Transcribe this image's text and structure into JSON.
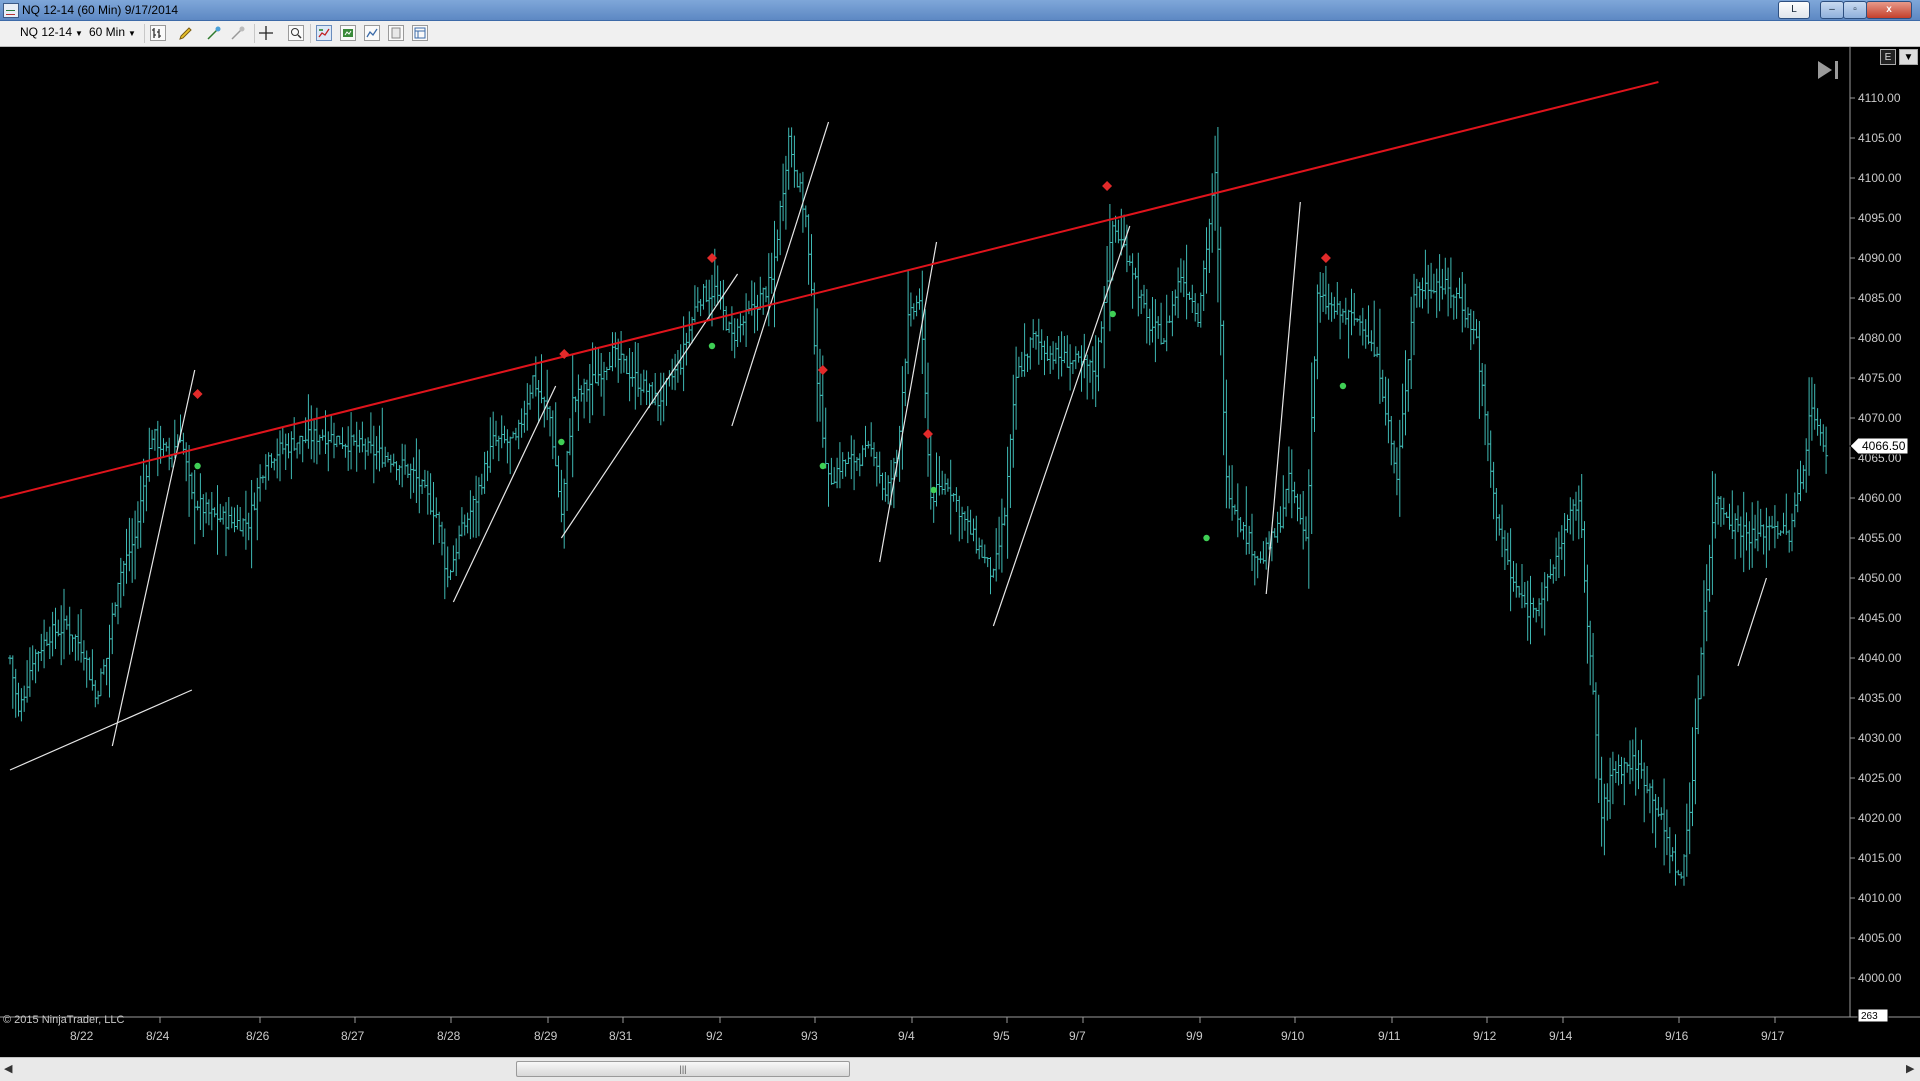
{
  "window": {
    "title": "NQ 12-14 (60 Min)  9/17/2014",
    "btn_l": "L",
    "btn_min": "–",
    "btn_max": "▫",
    "btn_close": "x"
  },
  "toolbar": {
    "instrument": "NQ 12-14",
    "interval": "60 Min",
    "icons": [
      "bar-type-icon",
      "drawing-pencil-icon",
      "draw-tools-icon",
      "drawing-objects-icon",
      "crosshair-icon",
      "data-box-icon",
      "indicators-icon",
      "strategies-icon",
      "chart-properties-icon",
      "templates-icon",
      "chart-panel-icon"
    ]
  },
  "chart": {
    "copyright": "© 2015 NinjaTrader, LLC",
    "current_price_label": "4066.50",
    "bottom_badge": "263",
    "corner_icon": "E",
    "scroll_to_end_icon": "scroll-to-end-icon",
    "background": "#000000",
    "bar_color": "#3fb9b4",
    "trendline_color": "#e0141c",
    "channel_color": "#e6e6e6",
    "marker_up_color": "#3fcf55",
    "marker_down_color": "#e22a2a"
  },
  "chart_data": {
    "type": "bar",
    "title": "",
    "instrument": "NQ 12-14",
    "interval": "60 Min",
    "price_axis": {
      "ylim": [
        3998,
        4114
      ],
      "ticks": [
        "4110.00",
        "4105.00",
        "4100.00",
        "4095.00",
        "4090.00",
        "4085.00",
        "4080.00",
        "4075.00",
        "4070.00",
        "4065.00",
        "4060.00",
        "4055.00",
        "4050.00",
        "4045.00",
        "4040.00",
        "4035.00",
        "4030.00",
        "4025.00",
        "4020.00",
        "4015.00",
        "4010.00",
        "4005.00",
        "4000.00"
      ]
    },
    "date_axis": {
      "labels": [
        "8/22",
        "8/24",
        "8/26",
        "8/27",
        "8/28",
        "8/29",
        "8/31",
        "9/2",
        "9/3",
        "9/4",
        "9/5",
        "9/7",
        "9/9",
        "9/10",
        "9/11",
        "9/12",
        "9/14",
        "9/16",
        "9/17"
      ]
    },
    "grid": false,
    "legend": "none",
    "close_path": [
      {
        "i": 0,
        "p": 4040
      },
      {
        "i": 3,
        "p": 4033
      },
      {
        "i": 8,
        "p": 4040
      },
      {
        "i": 14,
        "p": 4043
      },
      {
        "i": 20,
        "p": 4044
      },
      {
        "i": 26,
        "p": 4041
      },
      {
        "i": 30,
        "p": 4035
      },
      {
        "i": 34,
        "p": 4040
      },
      {
        "i": 38,
        "p": 4050
      },
      {
        "i": 44,
        "p": 4055
      },
      {
        "i": 50,
        "p": 4068
      },
      {
        "i": 56,
        "p": 4065
      },
      {
        "i": 60,
        "p": 4068
      },
      {
        "i": 64,
        "p": 4060
      },
      {
        "i": 70,
        "p": 4058
      },
      {
        "i": 78,
        "p": 4057
      },
      {
        "i": 84,
        "p": 4057
      },
      {
        "i": 90,
        "p": 4065
      },
      {
        "i": 100,
        "p": 4067
      },
      {
        "i": 110,
        "p": 4068
      },
      {
        "i": 118,
        "p": 4067
      },
      {
        "i": 126,
        "p": 4066
      },
      {
        "i": 134,
        "p": 4065
      },
      {
        "i": 142,
        "p": 4063
      },
      {
        "i": 150,
        "p": 4058
      },
      {
        "i": 154,
        "p": 4050
      },
      {
        "i": 158,
        "p": 4055
      },
      {
        "i": 164,
        "p": 4060
      },
      {
        "i": 170,
        "p": 4067
      },
      {
        "i": 178,
        "p": 4067
      },
      {
        "i": 184,
        "p": 4075
      },
      {
        "i": 190,
        "p": 4070
      },
      {
        "i": 194,
        "p": 4058
      },
      {
        "i": 198,
        "p": 4072
      },
      {
        "i": 206,
        "p": 4075
      },
      {
        "i": 212,
        "p": 4078
      },
      {
        "i": 220,
        "p": 4075
      },
      {
        "i": 228,
        "p": 4072
      },
      {
        "i": 236,
        "p": 4077
      },
      {
        "i": 242,
        "p": 4085
      },
      {
        "i": 248,
        "p": 4086
      },
      {
        "i": 254,
        "p": 4080
      },
      {
        "i": 260,
        "p": 4083
      },
      {
        "i": 268,
        "p": 4087
      },
      {
        "i": 274,
        "p": 4105
      },
      {
        "i": 280,
        "p": 4095
      },
      {
        "i": 284,
        "p": 4075
      },
      {
        "i": 288,
        "p": 4062
      },
      {
        "i": 292,
        "p": 4064
      },
      {
        "i": 298,
        "p": 4065
      },
      {
        "i": 304,
        "p": 4066
      },
      {
        "i": 308,
        "p": 4060
      },
      {
        "i": 312,
        "p": 4065
      },
      {
        "i": 316,
        "p": 4082
      },
      {
        "i": 320,
        "p": 4085
      },
      {
        "i": 324,
        "p": 4060
      },
      {
        "i": 330,
        "p": 4062
      },
      {
        "i": 336,
        "p": 4057
      },
      {
        "i": 342,
        "p": 4053
      },
      {
        "i": 346,
        "p": 4050
      },
      {
        "i": 350,
        "p": 4058
      },
      {
        "i": 354,
        "p": 4075
      },
      {
        "i": 360,
        "p": 4080
      },
      {
        "i": 366,
        "p": 4078
      },
      {
        "i": 374,
        "p": 4077
      },
      {
        "i": 382,
        "p": 4076
      },
      {
        "i": 388,
        "p": 4094
      },
      {
        "i": 394,
        "p": 4090
      },
      {
        "i": 400,
        "p": 4082
      },
      {
        "i": 406,
        "p": 4080
      },
      {
        "i": 412,
        "p": 4088
      },
      {
        "i": 418,
        "p": 4083
      },
      {
        "i": 424,
        "p": 4100
      },
      {
        "i": 428,
        "p": 4062
      },
      {
        "i": 434,
        "p": 4056
      },
      {
        "i": 440,
        "p": 4052
      },
      {
        "i": 446,
        "p": 4056
      },
      {
        "i": 450,
        "p": 4062
      },
      {
        "i": 456,
        "p": 4055
      },
      {
        "i": 460,
        "p": 4085
      },
      {
        "i": 468,
        "p": 4083
      },
      {
        "i": 476,
        "p": 4082
      },
      {
        "i": 482,
        "p": 4076
      },
      {
        "i": 488,
        "p": 4062
      },
      {
        "i": 494,
        "p": 4086
      },
      {
        "i": 502,
        "p": 4087
      },
      {
        "i": 510,
        "p": 4085
      },
      {
        "i": 516,
        "p": 4080
      },
      {
        "i": 522,
        "p": 4060
      },
      {
        "i": 528,
        "p": 4050
      },
      {
        "i": 534,
        "p": 4046
      },
      {
        "i": 540,
        "p": 4048
      },
      {
        "i": 546,
        "p": 4055
      },
      {
        "i": 552,
        "p": 4060
      },
      {
        "i": 556,
        "p": 4040
      },
      {
        "i": 560,
        "p": 4020
      },
      {
        "i": 564,
        "p": 4026
      },
      {
        "i": 572,
        "p": 4027
      },
      {
        "i": 578,
        "p": 4023
      },
      {
        "i": 584,
        "p": 4016
      },
      {
        "i": 588,
        "p": 4012
      },
      {
        "i": 592,
        "p": 4025
      },
      {
        "i": 596,
        "p": 4046
      },
      {
        "i": 600,
        "p": 4060
      },
      {
        "i": 606,
        "p": 4057
      },
      {
        "i": 614,
        "p": 4055
      },
      {
        "i": 620,
        "p": 4057
      },
      {
        "i": 626,
        "p": 4055
      },
      {
        "i": 630,
        "p": 4062
      },
      {
        "i": 634,
        "p": 4072
      },
      {
        "i": 638,
        "p": 4066
      }
    ],
    "n_bars": 640,
    "trendline": [
      {
        "i": 0,
        "p": 4060
      },
      {
        "i": 580,
        "p": 4112
      }
    ],
    "channel_lines": [
      [
        {
          "i": 0,
          "p": 4026
        },
        {
          "i": 64,
          "p": 4036
        }
      ],
      [
        {
          "i": 36,
          "p": 4029
        },
        {
          "i": 65,
          "p": 4076
        }
      ],
      [
        {
          "i": 156,
          "p": 4047
        },
        {
          "i": 192,
          "p": 4074
        }
      ],
      [
        {
          "i": 194,
          "p": 4055
        },
        {
          "i": 256,
          "p": 4088
        }
      ],
      [
        {
          "i": 254,
          "p": 4069
        },
        {
          "i": 288,
          "p": 4107
        }
      ],
      [
        {
          "i": 306,
          "p": 4052
        },
        {
          "i": 326,
          "p": 4092
        }
      ],
      [
        {
          "i": 346,
          "p": 4044
        },
        {
          "i": 394,
          "p": 4094
        }
      ],
      [
        {
          "i": 442,
          "p": 4048
        },
        {
          "i": 454,
          "p": 4097
        }
      ],
      [
        {
          "i": 608,
          "p": 4039
        },
        {
          "i": 618,
          "p": 4050
        }
      ]
    ],
    "markers_down": [
      {
        "i": 66,
        "p": 4073
      },
      {
        "i": 195,
        "p": 4078
      },
      {
        "i": 247,
        "p": 4090
      },
      {
        "i": 286,
        "p": 4076
      },
      {
        "i": 323,
        "p": 4068
      },
      {
        "i": 386,
        "p": 4099
      },
      {
        "i": 463,
        "p": 4090
      }
    ],
    "markers_up": [
      {
        "i": 66,
        "p": 4064
      },
      {
        "i": 194,
        "p": 4067
      },
      {
        "i": 247,
        "p": 4079
      },
      {
        "i": 286,
        "p": 4064
      },
      {
        "i": 325,
        "p": 4061
      },
      {
        "i": 388,
        "p": 4083
      },
      {
        "i": 421,
        "p": 4055
      },
      {
        "i": 469,
        "p": 4074
      }
    ]
  }
}
